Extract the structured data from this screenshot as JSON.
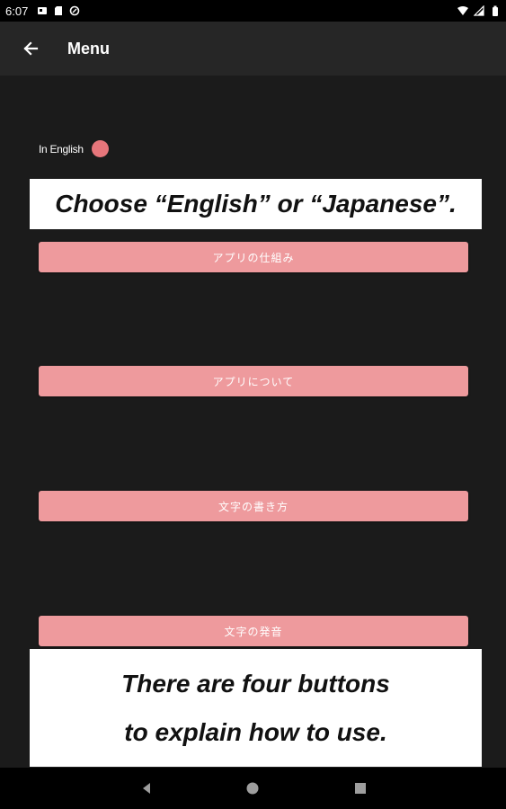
{
  "status_bar": {
    "time": "6:07"
  },
  "app_bar": {
    "title": "Menu",
    "back_icon": "arrow-left-icon"
  },
  "language": {
    "label": "In English",
    "toggle_color": "#e7767b"
  },
  "caption_top": {
    "text": "Choose “English” or “Japanese”."
  },
  "menu_buttons": [
    {
      "label": "アプリの仕組み"
    },
    {
      "label": "アプリについて"
    },
    {
      "label": "文字の書き方"
    },
    {
      "label": "文字の発音"
    }
  ],
  "caption_bottom": {
    "line1": "There are four buttons",
    "line2": "to explain how to use."
  },
  "colors": {
    "background": "#1b1b1b",
    "app_bar": "#262626",
    "button": "#ee9a9d"
  }
}
